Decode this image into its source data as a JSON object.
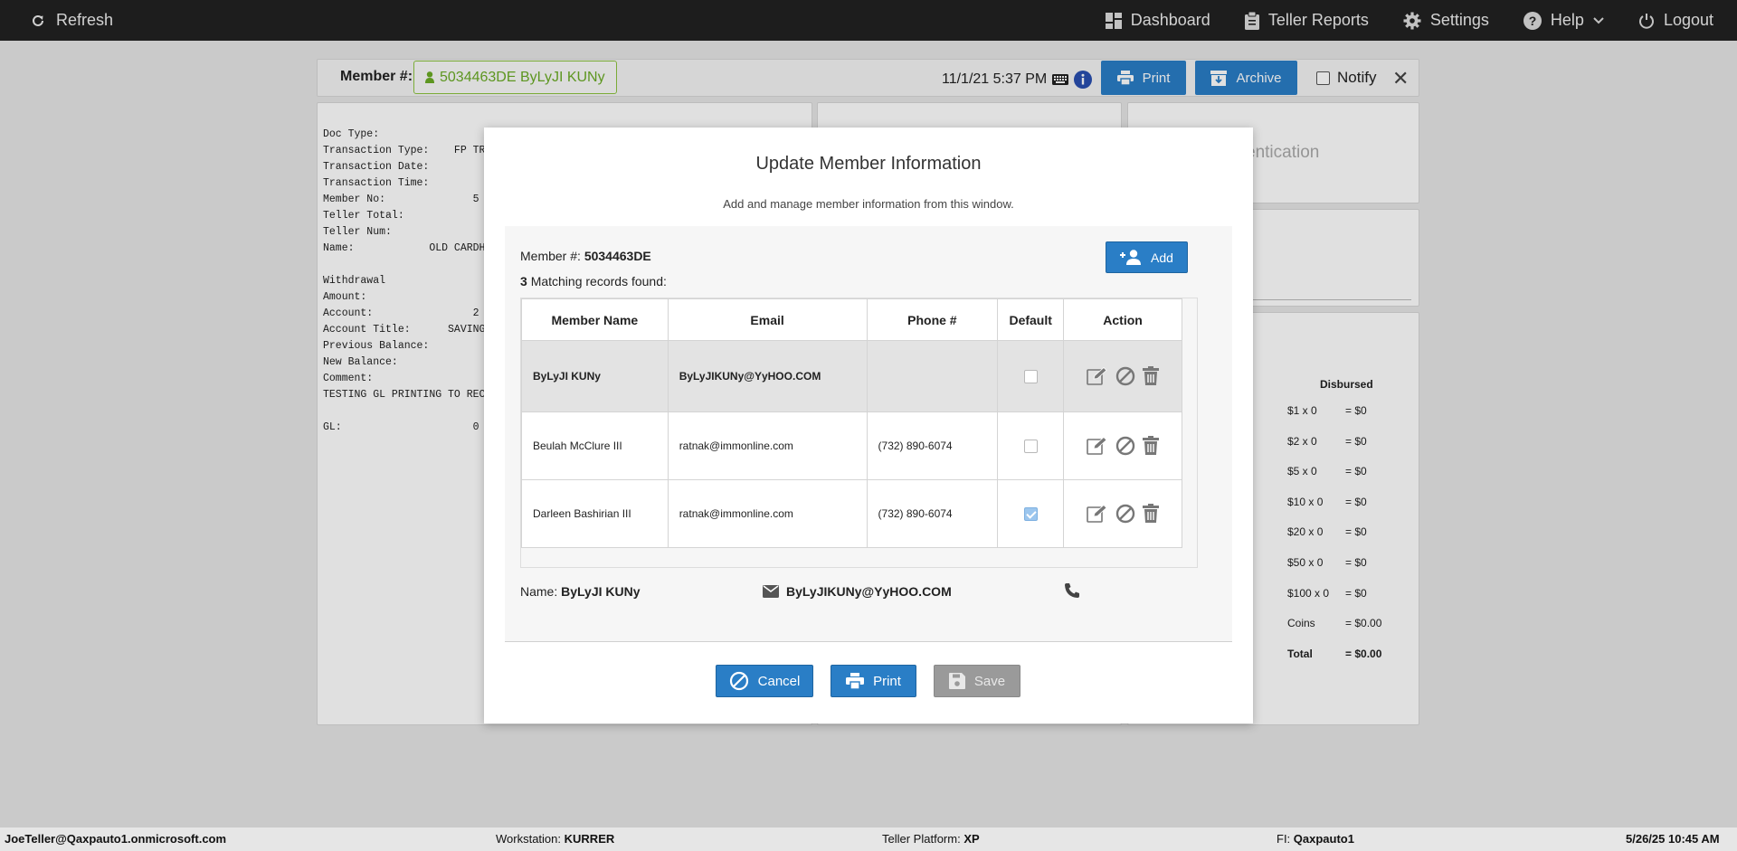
{
  "topbar": {
    "refresh_label": "Refresh",
    "nav": {
      "dashboard": "Dashboard",
      "teller_reports": "Teller Reports",
      "settings": "Settings",
      "help": "Help",
      "logout": "Logout"
    }
  },
  "member_bar": {
    "label": "Member #:",
    "member_chip": "5034463DE ByLyJI KUNy",
    "datetime": "11/1/21 5:37 PM",
    "print_label": "Print",
    "archive_label": "Archive",
    "notify_label": "Notify"
  },
  "receipt": {
    "lines": "Doc Type:\nTransaction Type:    FP TRA\nTransaction Date:\nTransaction Time:\nMember No:              5\nTeller Total:\nTeller Num:\nName:            OLD CARDH\n\nWithdrawal\nAmount:\nAccount:                2\nAccount Title:      SAVINGS\nPrevious Balance:\nNew Balance:\nComment:\nTESTING GL PRINTING TO RECE\n\nGL:                     0"
  },
  "auth_panel": {
    "partial_title": "entication"
  },
  "disbursed": {
    "header": "Disbursed",
    "rows": [
      {
        "label": "$1 x 0",
        "value": "= $0"
      },
      {
        "label": "$2 x 0",
        "value": "= $0"
      },
      {
        "label": "$5 x 0",
        "value": "= $0"
      },
      {
        "label": "$10 x 0",
        "value": "= $0"
      },
      {
        "label": "$20 x 0",
        "value": "= $0"
      },
      {
        "label": "$50 x 0",
        "value": "= $0"
      },
      {
        "label": "$100 x 0",
        "value": "= $0"
      },
      {
        "label": "Coins",
        "value": "= $0.00"
      },
      {
        "label": "Total",
        "value": "= $0.00"
      }
    ]
  },
  "modal": {
    "title": "Update Member Information",
    "subtitle": "Add and manage member information from this window.",
    "member_label": "Member #:",
    "member_number": "5034463DE",
    "match_count": "3",
    "match_text": "Matching records found:",
    "add_label": "Add",
    "table": {
      "headers": [
        "Member Name",
        "Email",
        "Phone #",
        "Default",
        "Action"
      ],
      "rows": [
        {
          "name": "ByLyJI KUNy",
          "email": "ByLyJIKUNy@YyHOO.COM",
          "phone": "",
          "default": false
        },
        {
          "name": "Beulah McClure III",
          "email": "ratnak@immonline.com",
          "phone": "(732) 890-6074",
          "default": false
        },
        {
          "name": "Darleen Bashirian III",
          "email": "ratnak@immonline.com",
          "phone": "(732) 890-6074",
          "default": true
        }
      ]
    },
    "summary": {
      "name_label": "Name:",
      "name_value": "ByLyJI KUNy",
      "email_value": "ByLyJIKUNy@YyHOO.COM"
    },
    "buttons": {
      "cancel": "Cancel",
      "print": "Print",
      "save": "Save"
    }
  },
  "status_bar": {
    "user": "JoeTeller@Qaxpauto1.onmicrosoft.com",
    "workstation_label": "Workstation:",
    "workstation_value": "KURRER",
    "platform_label": "Teller Platform:",
    "platform_value": "XP",
    "fi_label": "FI:",
    "fi_value": "Qaxpauto1",
    "datetime": "5/26/25 10:45 AM"
  },
  "colors": {
    "primary": "#2a7ec6",
    "member_chip": "#6aab25",
    "topbar": "#222222",
    "disabled": "#9a9a9a"
  }
}
